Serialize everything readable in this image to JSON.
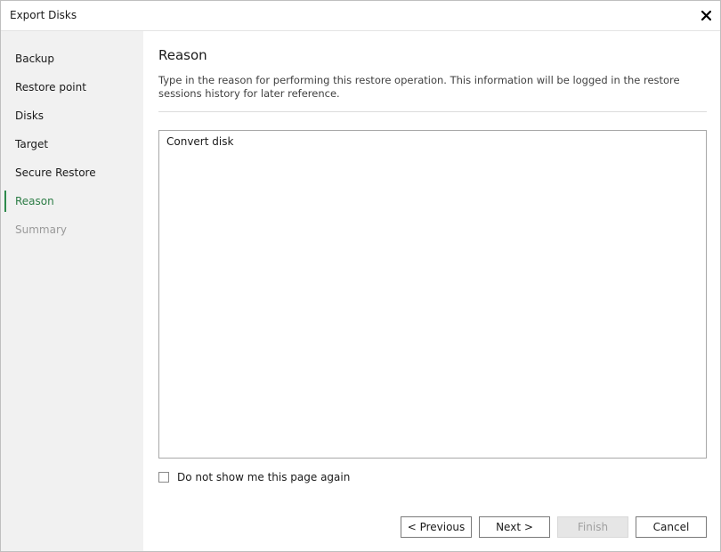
{
  "window": {
    "title": "Export Disks",
    "close_icon": "close-icon"
  },
  "sidebar": {
    "items": [
      {
        "label": "Backup",
        "state": "normal"
      },
      {
        "label": "Restore point",
        "state": "normal"
      },
      {
        "label": "Disks",
        "state": "normal"
      },
      {
        "label": "Target",
        "state": "normal"
      },
      {
        "label": "Secure Restore",
        "state": "normal"
      },
      {
        "label": "Reason",
        "state": "active"
      },
      {
        "label": "Summary",
        "state": "disabled"
      }
    ]
  },
  "main": {
    "heading": "Reason",
    "description": "Type in the reason for performing this restore operation. This information will be logged in the restore sessions history for later reference.",
    "reason_value": "Convert disk",
    "checkbox_label": "Do not show me this page again",
    "checkbox_checked": false
  },
  "buttons": {
    "previous": "< Previous",
    "next": "Next >",
    "finish": "Finish",
    "cancel": "Cancel"
  },
  "colors": {
    "accent": "#2d8a4b",
    "sidebar_bg": "#f1f1f1",
    "disabled_text": "#9a9a9a"
  }
}
